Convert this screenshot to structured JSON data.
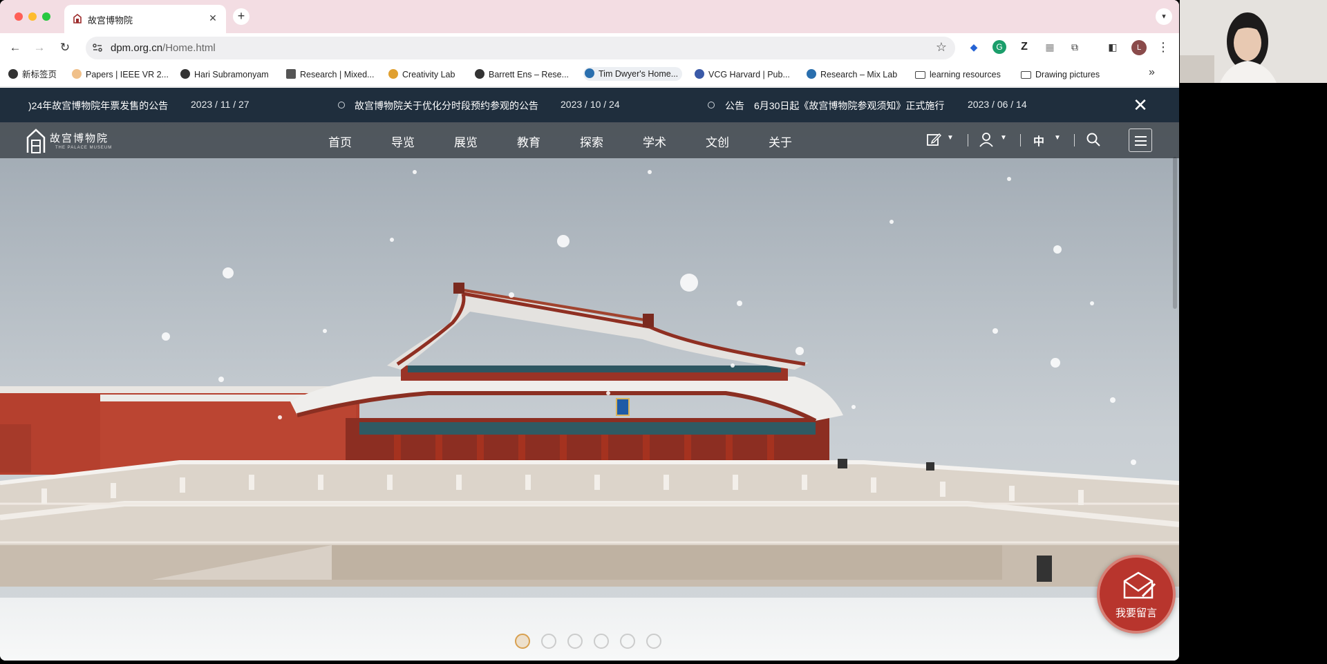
{
  "browser": {
    "tab_title": "故宫博物院",
    "tab_close": "✕",
    "new_tab": "+",
    "url_host": "dpm.org.cn",
    "url_path": "/Home.html",
    "profile_initial": "L",
    "bookmarks": [
      {
        "label": "新标签页",
        "icon": "globe-icon"
      },
      {
        "label": "Papers | IEEE VR 2...",
        "icon": "ieee-icon"
      },
      {
        "label": "Hari Subramonyam",
        "icon": "globe-icon"
      },
      {
        "label": "Research | Mixed...",
        "icon": "mixed-icon"
      },
      {
        "label": "Creativity Lab",
        "icon": "creativity-icon"
      },
      {
        "label": "Barrett Ens – Rese...",
        "icon": "globe-icon"
      },
      {
        "label": "Tim Dwyer's Home...",
        "icon": "wordpress-icon"
      },
      {
        "label": "VCG Harvard | Pub...",
        "icon": "vcg-icon"
      },
      {
        "label": "Research – Mix Lab",
        "icon": "wordpress-icon"
      },
      {
        "label": "learning resources",
        "icon": "folder-icon"
      },
      {
        "label": "Drawing pictures",
        "icon": "folder-icon"
      }
    ],
    "bookmarks_more": "»"
  },
  "notices": [
    {
      "title": ")24年故宫博物院年票发售的公告",
      "date": "2023 / 11 / 27"
    },
    {
      "title": "故宫博物院关于优化分时段预约参观的公告",
      "date": "2023 / 10 / 24"
    },
    {
      "prefix": "公告",
      "title": "6月30日起《故宫博物院参观须知》正式施行",
      "date": "2023 / 06 / 14"
    }
  ],
  "notice_close": "✕",
  "site": {
    "logo_text": "故宫博物院",
    "logo_sub": "THE PALACE MUSEUM",
    "menu": [
      "首页",
      "导览",
      "展览",
      "教育",
      "探索",
      "学术",
      "文创",
      "关于"
    ],
    "lang": "中",
    "message_label": "我要留言"
  },
  "colors": {
    "notice_bg": "#1f2e3d",
    "nav_bg": "#3e444a",
    "message_red": "#b8352d",
    "wall_red": "#b5402e",
    "tab_strip": "#f3dde3"
  }
}
